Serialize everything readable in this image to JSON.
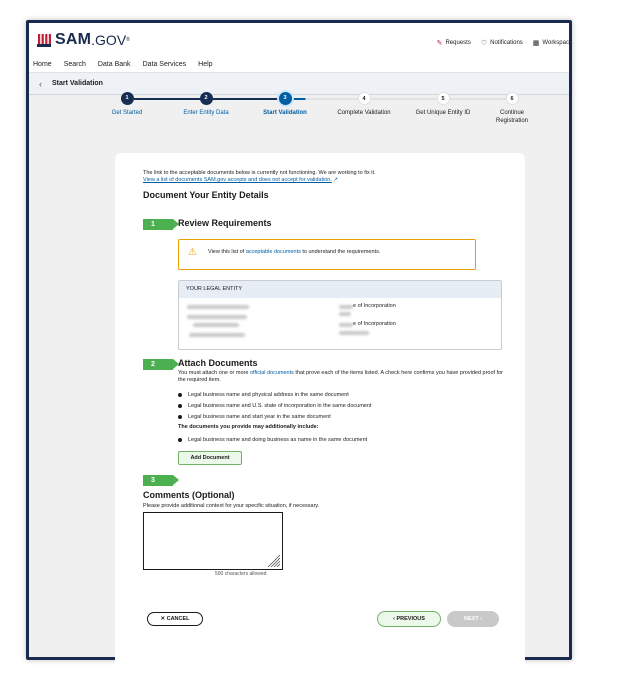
{
  "header": {
    "logo_text": "SAM",
    "logo_suffix": ".GOV",
    "registered": "®",
    "requests": "Requests",
    "notifications": "Notifications",
    "workspace": "Workspac"
  },
  "nav": [
    "Home",
    "Search",
    "Data Bank",
    "Data Services",
    "Help"
  ],
  "subbar": {
    "title": "Start Validation"
  },
  "stepper": {
    "steps": [
      {
        "num": "1",
        "label": "Get Started",
        "state": "done"
      },
      {
        "num": "2",
        "label": "Enter Entity Data",
        "state": "done"
      },
      {
        "num": "3",
        "label": "Start Validation",
        "state": "current"
      },
      {
        "num": "4",
        "label": "Complete Validation",
        "state": "todo"
      },
      {
        "num": "5",
        "label": "Get Unique Entity ID",
        "state": "todo"
      },
      {
        "num": "6",
        "label": "Continue Registration",
        "state": "todo"
      }
    ]
  },
  "banner": {
    "text": "The link to the acceptable documents below is currently not functioning. We are working to fix it.",
    "link": "View a list of documents SAM.gov accepts and does not accept for validation."
  },
  "document_title": "Document Your Entity Details",
  "section1": {
    "num": "1",
    "title": "Review Requirements",
    "alert_pre": "View this list of ",
    "alert_link": "acceptable documents",
    "alert_post": " to understand the requirements."
  },
  "entity": {
    "header": "YOUR LEGAL ENTITY",
    "label1": "e of Incorporation",
    "label2": "e of Incorporation"
  },
  "section2": {
    "num": "2",
    "title": "Attach Documents",
    "intro_pre": "You must attach one or more ",
    "intro_link": "official documents",
    "intro_post": " that prove each of the items listed. A check here confirms you have provided proof for the required item.",
    "items": [
      "Legal business name and physical address in the same document",
      "Legal business name and U.S. state of incorporation in the same document",
      "Legal business name and start year in the same document"
    ],
    "additional_heading": "The documents you provide may additionally include:",
    "additional_items": [
      "Legal business name and doing business as name in the same document"
    ],
    "add_button": "Add Document"
  },
  "section3": {
    "num": "3",
    "title": "Comments (Optional)",
    "hint": "Please provide additional context for your specific situation, if necessary.",
    "value": "",
    "char_count": "500 characters allowed"
  },
  "buttons": {
    "cancel": "CANCEL",
    "previous": "PREVIOUS",
    "next": "NEXT"
  },
  "colors": {
    "brand_navy": "#162e51",
    "primary": "#005ea2",
    "success": "#4caf50",
    "warning": "#e5a000"
  }
}
